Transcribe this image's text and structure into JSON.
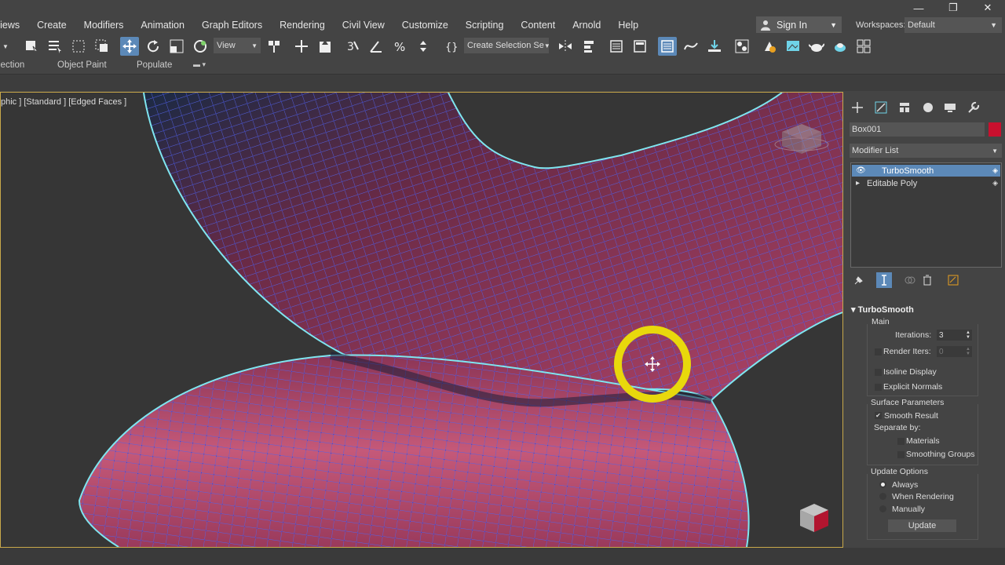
{
  "menu": [
    "Views",
    "Create",
    "Modifiers",
    "Animation",
    "Graph Editors",
    "Rendering",
    "Civil View",
    "Customize",
    "Scripting",
    "Content",
    "Arnold",
    "Help"
  ],
  "account": {
    "sign_in": "Sign In",
    "workspaces_label": "Workspaces:",
    "workspace": "Default"
  },
  "window_controls": {
    "minimize": "—",
    "restore": "❐",
    "close": "✕"
  },
  "toolbar": {
    "ref_coord": "View",
    "selection_set": "Create Selection Se"
  },
  "ribbon": {
    "tab1": "lection",
    "tab2": "Object Paint",
    "tab3": "Populate"
  },
  "viewport": {
    "label": "phic ] [Standard ] [Edged Faces ]",
    "mesh_color": "#a63a5c",
    "wire_color": "#3f4fd6",
    "selection_outline": "#7fe6f0",
    "cursor_highlight": "#e8d80c"
  },
  "command_panel": {
    "object_name": "Box001",
    "object_color": "#c8102e",
    "modifier_list": "Modifier List",
    "stack": [
      "TurboSmooth",
      "Editable Poly"
    ],
    "rollout_title": "TurboSmooth",
    "main": {
      "title": "Main",
      "iterations_label": "Iterations:",
      "iterations": "3",
      "render_iters_label": "Render Iters:",
      "render_iters": "0",
      "isoline": "Isoline Display",
      "explicit_normals": "Explicit Normals"
    },
    "surface": {
      "title": "Surface Parameters",
      "smooth_result": "Smooth Result",
      "separate_by": "Separate by:",
      "materials": "Materials",
      "smoothing_groups": "Smoothing Groups"
    },
    "update": {
      "title": "Update Options",
      "always": "Always",
      "when_rendering": "When Rendering",
      "manually": "Manually",
      "button": "Update"
    }
  }
}
